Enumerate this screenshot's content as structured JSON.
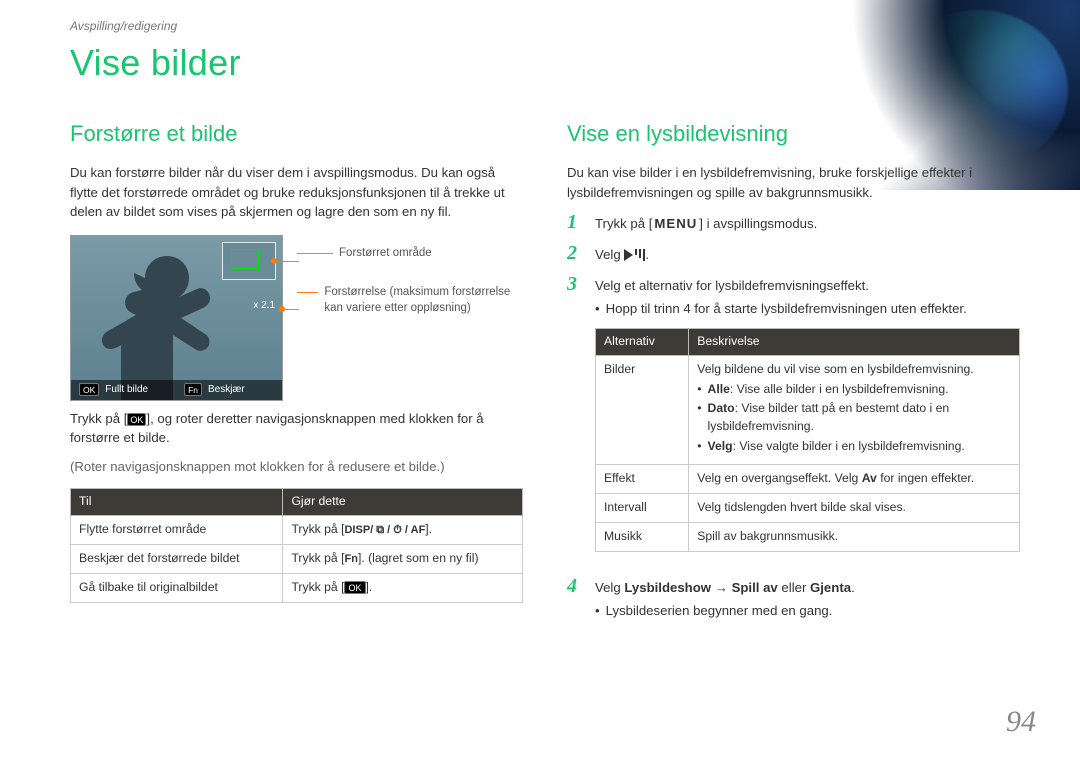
{
  "breadcrumb": "Avspilling/redigering",
  "page_title": "Vise bilder",
  "page_number": "94",
  "left": {
    "heading": "Forstørre et bilde",
    "intro": "Du kan forstørre bilder når du viser dem i avspillingsmodus. Du kan også flytte det forstørrede området og bruke reduksjonsfunksjonen til å trekke ut delen av bildet som vises på skjermen og lagre den som en ny fil.",
    "screen": {
      "zoom_text": "x 2.1",
      "btn_ok": "OK",
      "btn_ok_label": "Fullt bilde",
      "btn_fn": "Fn",
      "btn_fn_label": "Beskjær"
    },
    "callouts": {
      "c1": "Forstørret område",
      "c2": "Forstørrelse (maksimum forstørrelse kan variere etter oppløsning)"
    },
    "action_line_a": "Trykk på [",
    "action_key": "OK",
    "action_line_b": "], og roter deretter navigasjonsknappen med klokken for å forstørre et bilde.",
    "note": "(Roter navigasjonsknappen mot klokken for å redusere et bilde.)",
    "table": {
      "th1": "Til",
      "th2": "Gjør dette",
      "rows": [
        {
          "a": "Flytte forstørret område",
          "b_pre": "Trykk på [",
          "b_keys": "DISP/ ⧉ / ⏱ / AF",
          "b_post": "]."
        },
        {
          "a": "Beskjær det forstørrede bildet",
          "b_pre": "Trykk på [",
          "b_keys": "Fn",
          "b_post": "]. (lagret som en ny fil)"
        },
        {
          "a": "Gå tilbake til originalbildet",
          "b_pre": "Trykk på [",
          "b_keys": "OK",
          "b_post": "]."
        }
      ]
    }
  },
  "right": {
    "heading": "Vise en lysbildevisning",
    "intro": "Du kan vise bilder i en lysbildefremvisning, bruke forskjellige effekter i lysbildefremvisningen og spille av bakgrunnsmusikk.",
    "steps": {
      "s1_a": "Trykk på [",
      "s1_menu": "MENU",
      "s1_b": "] i avspillingsmodus.",
      "s2_a": "Velg ",
      "s2_b": ".",
      "s3": "Velg et alternativ for lysbildefremvisningseffekt.",
      "s3_sub": "Hopp til trinn 4 for å starte lysbildefremvisningen uten effekter.",
      "s4_a": "Velg ",
      "s4_b": "Lysbildeshow",
      "s4_c": " → ",
      "s4_d": "Spill av",
      "s4_e": " eller ",
      "s4_f": "Gjenta",
      "s4_g": ".",
      "s4_sub": "Lysbildeserien begynner med en gang."
    },
    "table": {
      "th1": "Alternativ",
      "th2": "Beskrivelse",
      "rows": [
        {
          "a": "Bilder",
          "b_lead": "Velg bildene du vil vise som en lysbildefremvisning.",
          "subs": [
            {
              "bold": "Alle",
              "rest": ": Vise alle bilder i en lysbildefremvisning."
            },
            {
              "bold": "Dato",
              "rest": ": Vise bilder tatt på en bestemt dato i en lysbildefremvisning."
            },
            {
              "bold": "Velg",
              "rest": ": Vise valgte bilder i en lysbildefremvisning."
            }
          ]
        },
        {
          "a": "Effekt",
          "b": "Velg en overgangseffekt. Velg ",
          "b_bold": "Av",
          "b_post": " for ingen effekter."
        },
        {
          "a": "Intervall",
          "b": "Velg tidslengden hvert bilde skal vises."
        },
        {
          "a": "Musikk",
          "b": "Spill av bakgrunnsmusikk."
        }
      ]
    }
  }
}
